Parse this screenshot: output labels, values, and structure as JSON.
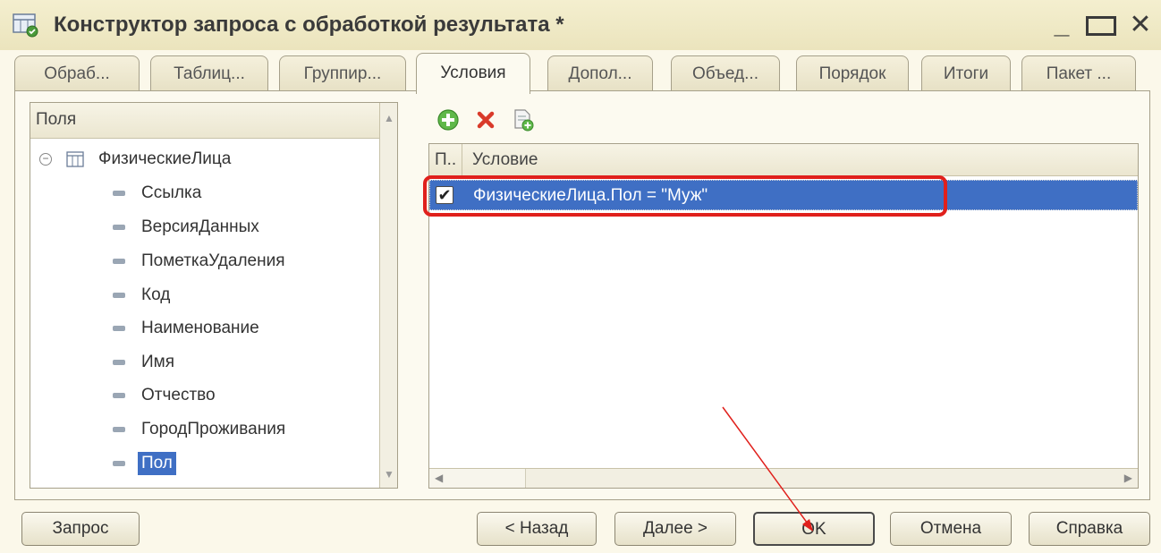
{
  "window": {
    "title": "Конструктор запроса с обработкой результата *",
    "minimize": "_",
    "close": "✕"
  },
  "tabs": [
    {
      "label": "Обраб..."
    },
    {
      "label": "Таблиц..."
    },
    {
      "label": "Группир..."
    },
    {
      "label": "Условия"
    },
    {
      "label": "Допол..."
    },
    {
      "label": "Объед..."
    },
    {
      "label": "Порядок"
    },
    {
      "label": "Итоги"
    },
    {
      "label": "Пакет ..."
    }
  ],
  "fields": {
    "header": "Поля",
    "root": "ФизическиеЛица",
    "items": [
      "Ссылка",
      "ВерсияДанных",
      "ПометкаУдаления",
      "Код",
      "Наименование",
      "Имя",
      "Отчество",
      "ГородПроживания",
      "Пол"
    ]
  },
  "grid": {
    "col1_header": "П..",
    "col2_header": "Условие",
    "rows": [
      {
        "checked": true,
        "check_glyph": "✔",
        "condition": "ФизическиеЛица.Пол = \"Муж\""
      }
    ]
  },
  "buttons": {
    "query": "Запрос",
    "back": "< Назад",
    "next": "Далее >",
    "ok": "OK",
    "cancel": "Отмена",
    "help": "Справка"
  },
  "colors": {
    "selection": "#3f6fc4",
    "highlight": "#e0201c",
    "background": "#fbf8ea"
  }
}
